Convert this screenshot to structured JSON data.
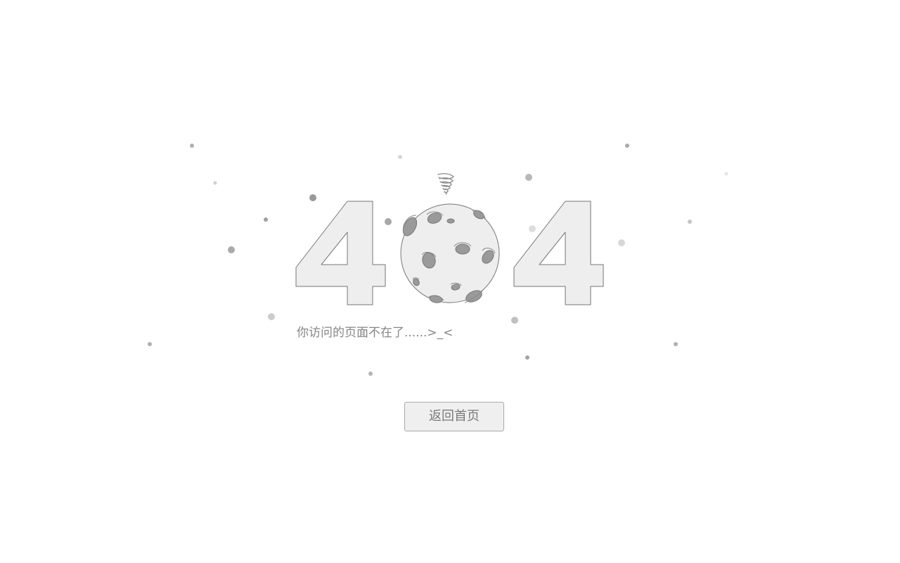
{
  "error_code_digits": [
    "4",
    "0",
    "4"
  ],
  "message": "你访问的页面不在了......>_<",
  "home_button": {
    "label": "返回首页"
  },
  "colors": {
    "background": "#ffffff",
    "digit_fill": "#eeeeee",
    "outline": "#777777",
    "crater": "#9a9a9a",
    "text": "#858585",
    "button_fill": "#efefef",
    "button_border": "#a9a9a9"
  },
  "icons": {
    "planet": "moon-planet-icon",
    "tornado": "tornado-swirl-icon",
    "stars": "star-dot-icon"
  }
}
